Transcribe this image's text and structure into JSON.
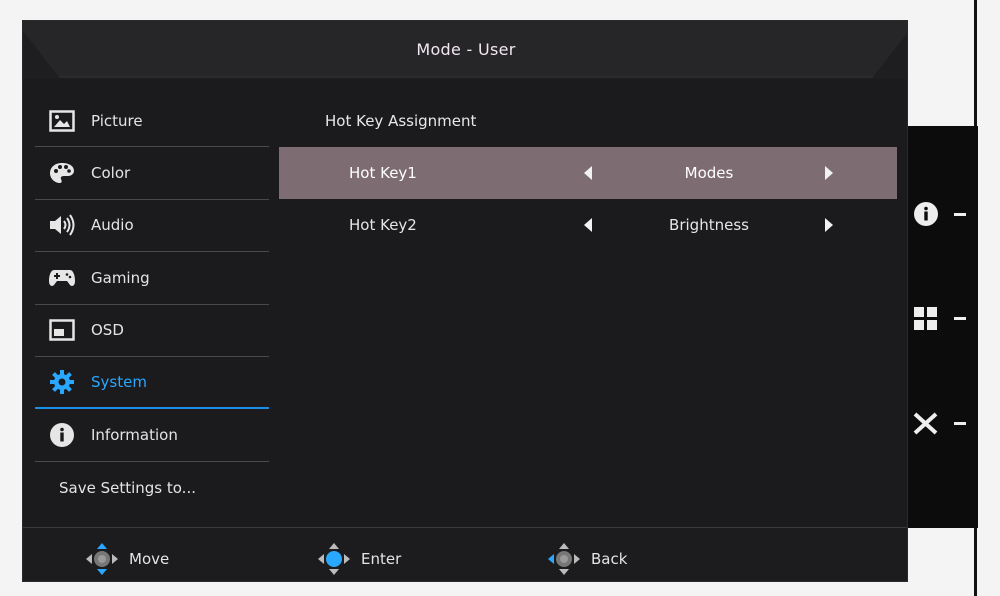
{
  "header": {
    "title": "Mode - User"
  },
  "sidebar": {
    "items": [
      {
        "label": "Picture",
        "icon": "picture-icon"
      },
      {
        "label": "Color",
        "icon": "palette-icon"
      },
      {
        "label": "Audio",
        "icon": "speaker-icon"
      },
      {
        "label": "Gaming",
        "icon": "gamepad-icon"
      },
      {
        "label": "OSD",
        "icon": "osd-window-icon"
      },
      {
        "label": "System",
        "icon": "gear-icon",
        "active": true
      },
      {
        "label": "Information",
        "icon": "info-icon"
      },
      {
        "label": "Save Settings to..."
      }
    ]
  },
  "content": {
    "section_title": "Hot Key Assignment",
    "rows": [
      {
        "label": "Hot Key1",
        "value": "Modes",
        "selected": true
      },
      {
        "label": "Hot Key2",
        "value": "Brightness",
        "selected": false
      }
    ]
  },
  "footer": {
    "hints": [
      {
        "label": "Move",
        "icon": "dpad-move-icon"
      },
      {
        "label": "Enter",
        "icon": "dpad-enter-icon"
      },
      {
        "label": "Back",
        "icon": "dpad-back-icon"
      }
    ]
  },
  "bezel": {
    "buttons": [
      {
        "icon": "info-icon"
      },
      {
        "icon": "grid-icon"
      },
      {
        "icon": "close-icon"
      }
    ]
  },
  "colors": {
    "accent": "#2aa7ff",
    "selected_row": "#7e6c73",
    "panel_bg": "#1b1b1d"
  }
}
